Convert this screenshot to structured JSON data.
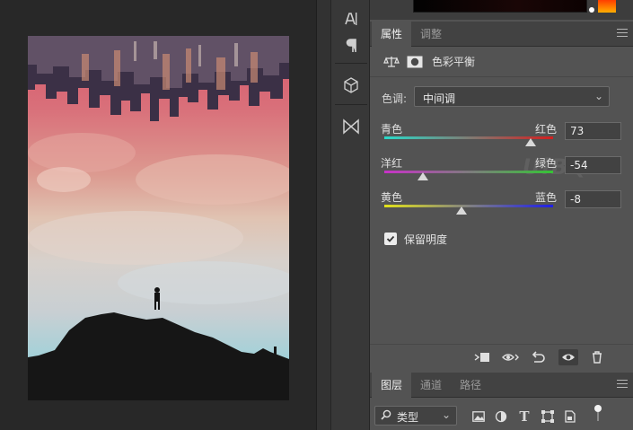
{
  "properties_panel": {
    "tabs": [
      {
        "label": "属性",
        "active": true
      },
      {
        "label": "调整",
        "active": false
      }
    ],
    "adjustment_title": "色彩平衡",
    "tone": {
      "label": "色调:",
      "value": "中间调"
    },
    "sliders": [
      {
        "left_label": "青色",
        "right_label": "红色",
        "value": "73",
        "level": 73,
        "gradient": [
          "#2ad9c9",
          "#d21f1f"
        ]
      },
      {
        "left_label": "洋红",
        "right_label": "绿色",
        "value": "-54",
        "level": -54,
        "gradient": [
          "#c832c8",
          "#35c435"
        ]
      },
      {
        "left_label": "黄色",
        "right_label": "蓝色",
        "value": "-8",
        "level": -8,
        "gradient": [
          "#e2e21a",
          "#1f1fe8"
        ]
      }
    ],
    "preserve_luminosity": {
      "label": "保留明度",
      "checked": true
    }
  },
  "layers_panel": {
    "tabs": [
      {
        "label": "图层",
        "active": true
      },
      {
        "label": "通道",
        "active": false
      },
      {
        "label": "路径",
        "active": false
      }
    ],
    "filter_kind": "类型"
  },
  "icons": {
    "strip": [
      "character-icon",
      "paragraph-icon",
      "3d-cube-icon",
      "properties-bowtie-icon"
    ],
    "footer": [
      "clip-to-layer-icon",
      "view-previous-icon",
      "reset-icon",
      "visibility-eye-icon",
      "trash-icon"
    ],
    "layer_filters": [
      "pixel-layer-filter-icon",
      "adjustment-layer-filter-icon",
      "type-layer-filter-icon",
      "shape-layer-filter-icon",
      "smart-object-filter-icon",
      "filter-toggle-icon"
    ]
  },
  "colors": {
    "accent_foreground": "#ff3d00",
    "panel_bg": "#535353",
    "canvas_bg": "#282828"
  }
}
